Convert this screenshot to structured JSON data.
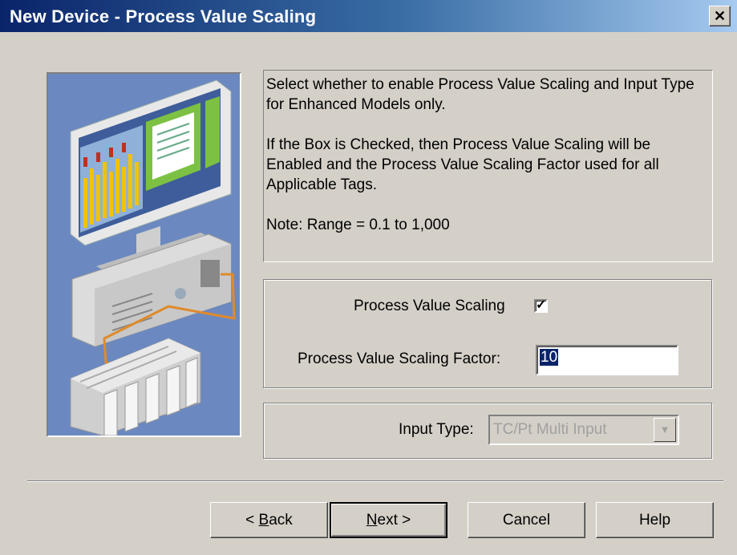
{
  "window": {
    "title": "New Device - Process Value Scaling",
    "close_glyph": "✕"
  },
  "description": {
    "paragraph1": "Select whether to enable Process Value Scaling and Input Type for Enhanced Models only.",
    "paragraph2": "If the Box is Checked, then Process Value Scaling will be Enabled and the Process Value Scaling Factor used for all Applicable Tags.",
    "paragraph3": "Note: Range = 0.1 to 1,000"
  },
  "scaling": {
    "checkbox_label": "Process Value Scaling",
    "checked": true,
    "check_glyph": "✓",
    "factor_label": "Process Value Scaling Factor:",
    "factor_value": "10"
  },
  "input_type": {
    "label": "Input Type:",
    "selected": "TC/Pt Multi Input",
    "arrow_glyph": "▼",
    "disabled": true
  },
  "buttons": {
    "back_prefix": "< ",
    "back_mnemonic": "B",
    "back_rest": "ack",
    "next_mnemonic": "N",
    "next_rest": "ext >",
    "cancel": "Cancel",
    "help": "Help"
  },
  "colors": {
    "title_gradient_start": "#0a246a",
    "title_gradient_end": "#a6caf0",
    "dialog_face": "#d4d0c8",
    "illustration_bg": "#6b89c0"
  }
}
